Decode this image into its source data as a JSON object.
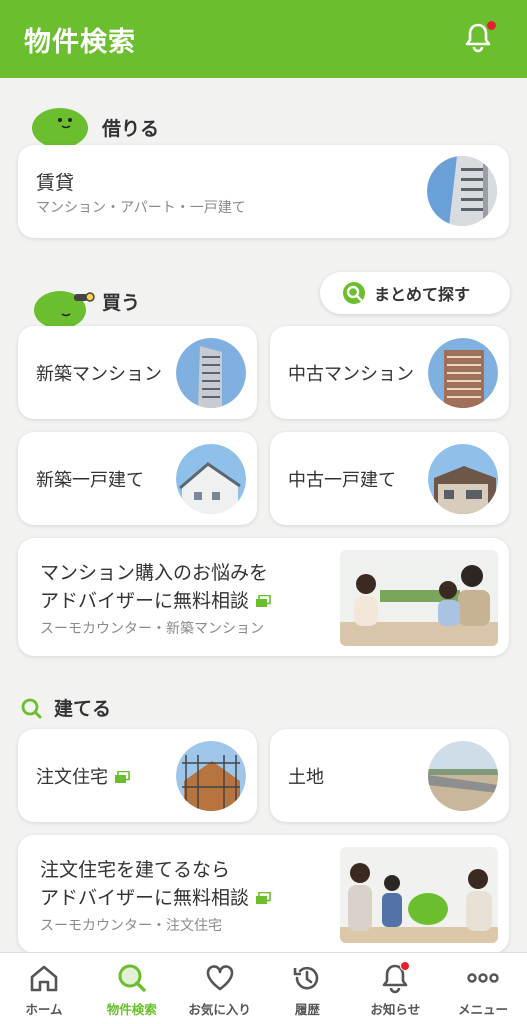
{
  "header": {
    "title": "物件検索"
  },
  "rent": {
    "section_title": "借りる",
    "card": {
      "title": "賃貸",
      "subtitle": "マンション・アパート・一戸建て"
    }
  },
  "buy": {
    "section_title": "買う",
    "bulk_search_label": "まとめて探す",
    "tiles": [
      {
        "label": "新築マンション"
      },
      {
        "label": "中古マンション"
      },
      {
        "label": "新築一戸建て"
      },
      {
        "label": "中古一戸建て"
      }
    ],
    "promo": {
      "line1": "マンション購入のお悩みを",
      "line2": "アドバイザーに無料相談",
      "subtitle": "スーモカウンター・新築マンション"
    }
  },
  "build": {
    "section_title": "建てる",
    "tiles": [
      {
        "label": "注文住宅"
      },
      {
        "label": "土地"
      }
    ],
    "promo": {
      "line1": "注文住宅を建てるなら",
      "line2": "アドバイザーに無料相談",
      "subtitle": "スーモカウンター・注文住宅"
    }
  },
  "nav": {
    "items": [
      {
        "label": "ホーム",
        "icon": "home-icon"
      },
      {
        "label": "物件検索",
        "icon": "search-icon"
      },
      {
        "label": "お気に入り",
        "icon": "heart-icon"
      },
      {
        "label": "履歴",
        "icon": "history-icon"
      },
      {
        "label": "お知らせ",
        "icon": "bell-icon"
      },
      {
        "label": "メニュー",
        "icon": "more-icon"
      }
    ]
  },
  "colors": {
    "brand_green": "#6bbf2f",
    "badge_red": "#e8202a"
  }
}
